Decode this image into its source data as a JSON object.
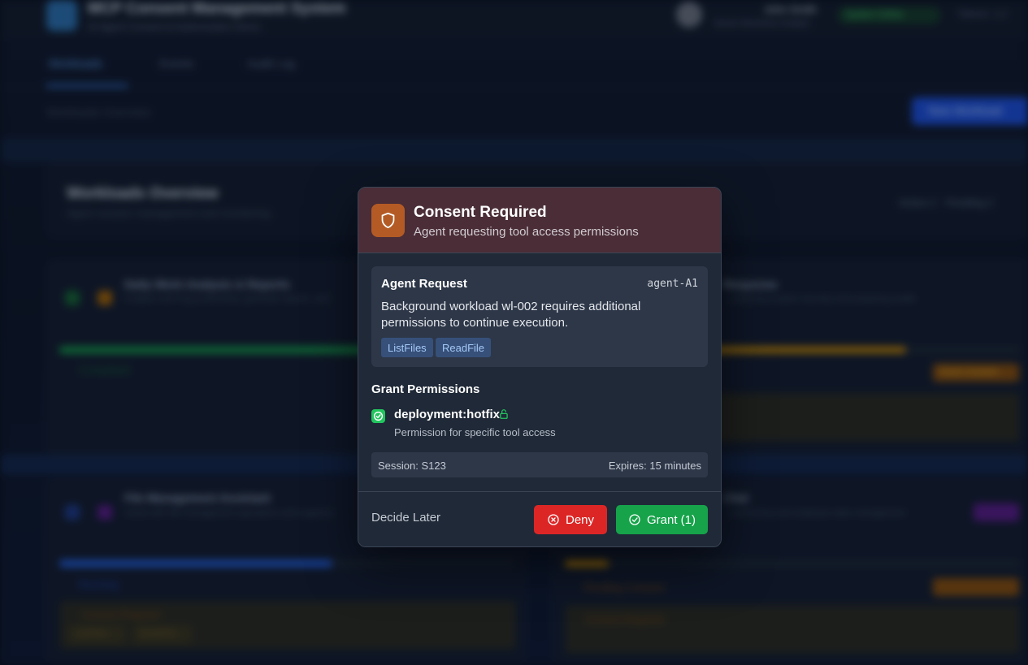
{
  "background": {
    "app_title": "MCP Consent Management System",
    "app_subtitle": "AI Agent Consent & Authorization Demo",
    "user_name": "John Smith",
    "user_role": "Senior Business Analyst",
    "system_status": "System Online",
    "tokens_label": "Tokens: 1,2",
    "tabs": [
      "Workloads",
      "Events",
      "Audit Log"
    ],
    "section_label": "Workloads Overview",
    "new_button": "New Workload",
    "overview_title": "Workloads Overview",
    "overview_subtitle": "Agent session management and monitoring",
    "overview_stats": "Active 2 · Pending 2",
    "cards": [
      {
        "title": "Daily Work Analysis & Reports",
        "text": "Analyze work log productivity, generate reports, and",
        "status": "Completed"
      },
      {
        "title": "Response",
        "text": "...analyzing system security and preparing audits",
        "status": "Grant Consent"
      },
      {
        "title": "File Management Assistant",
        "text": "Assist with file management operations and organize",
        "status": "Running",
        "consent": "Consent Required",
        "tools": [
          "ListFiles",
          "ReadFile"
        ]
      },
      {
        "title": "Chat",
        "text": "...monitoring and employee data management",
        "status": "Pending Consent",
        "consent": "Consent Required"
      }
    ]
  },
  "modal": {
    "title": "Consent Required",
    "subtitle": "Agent requesting tool access permissions",
    "request": {
      "heading": "Agent Request",
      "agent_id": "agent-A1",
      "message": "Background workload wl-002 requires additional permissions to continue execution.",
      "tools": [
        "ListFiles",
        "ReadFile"
      ]
    },
    "grant": {
      "heading": "Grant Permissions",
      "permission_name": "deployment:hotfix",
      "permission_desc": "Permission for specific tool access",
      "checked": true
    },
    "session_label": "Session: S123",
    "expires_label": "Expires: 15 minutes",
    "footer": {
      "later_label": "Decide Later",
      "deny_label": "Deny",
      "grant_label": "Grant (1)"
    }
  },
  "colors": {
    "header_bg": "#4a2d37",
    "shield_bg": "#b45b25",
    "deny": "#dc2626",
    "grant": "#16a34a",
    "tool_chip": "#36507a",
    "check": "#22c55e"
  }
}
